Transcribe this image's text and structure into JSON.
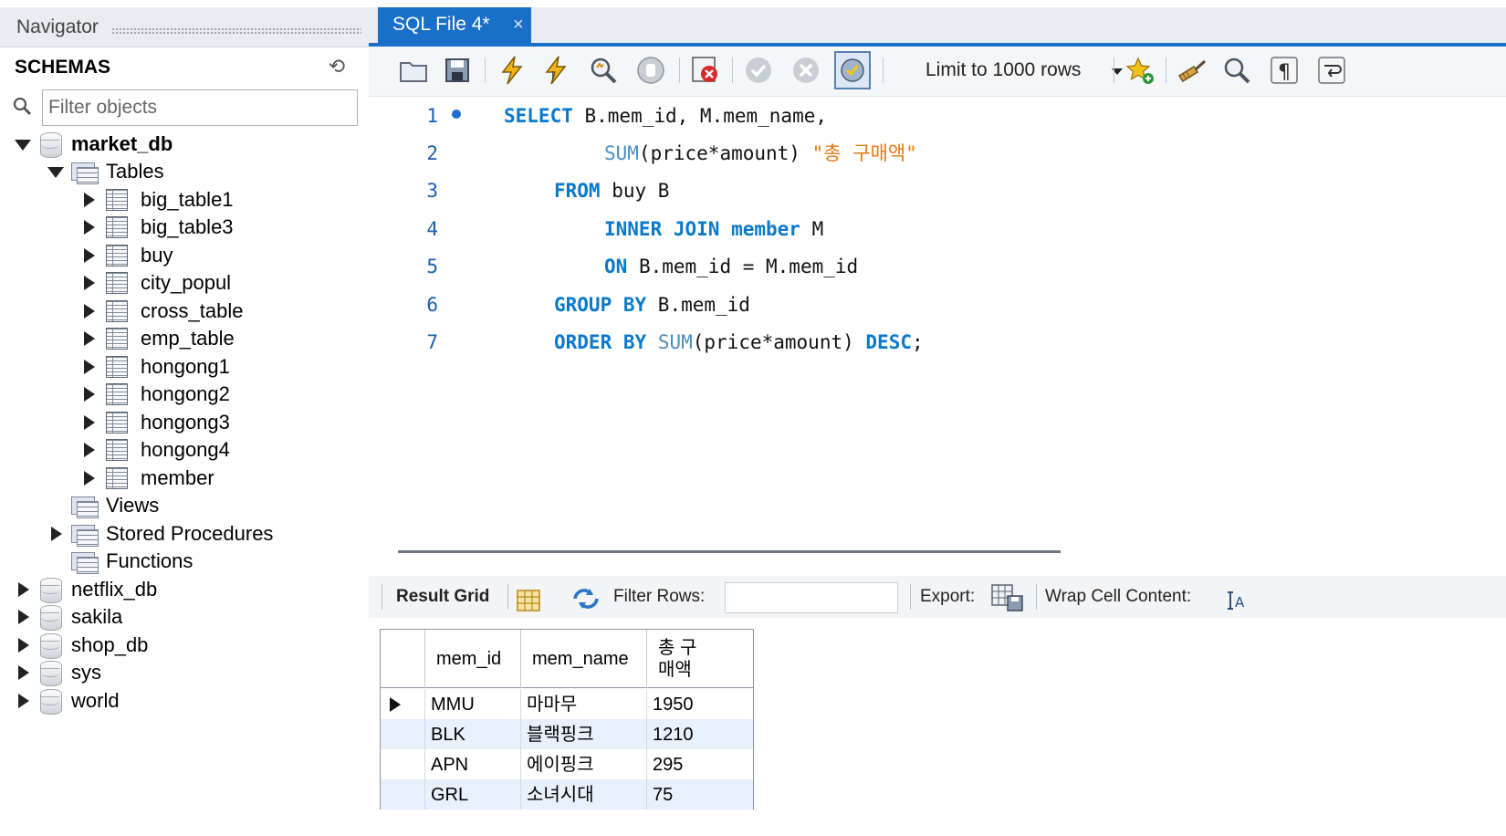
{
  "navigator": {
    "title": "Navigator",
    "schemas_label": "SCHEMAS",
    "filter_placeholder": "Filter objects",
    "tree": {
      "market_db": "market_db",
      "tables_folder": "Tables",
      "tables": [
        "big_table1",
        "big_table3",
        "buy",
        "city_popul",
        "cross_table",
        "emp_table",
        "hongong1",
        "hongong2",
        "hongong3",
        "hongong4",
        "member"
      ],
      "views_folder": "Views",
      "procedures_folder": "Stored Procedures",
      "functions_folder": "Functions",
      "other_dbs": [
        "netflix_db",
        "sakila",
        "shop_db",
        "sys",
        "world"
      ]
    }
  },
  "editor": {
    "tab_title": "SQL File 4*",
    "tab_close": "×",
    "limit_label": "Limit to 1000 rows",
    "line_numbers": [
      "1",
      "2",
      "3",
      "4",
      "5",
      "6",
      "7"
    ],
    "code": {
      "l1_kw": "SELECT",
      "l1_rest": " B.mem_id, M.mem_name,",
      "l2_fn": "SUM",
      "l2_rest": "(price*amount) ",
      "l2_str": "\"총 구매액\"",
      "l3_kw": "FROM",
      "l3_rest": " buy B",
      "l4_kw": "INNER JOIN",
      "l4_kw2": "member",
      "l4_rest": " M",
      "l5_kw": "ON",
      "l5_rest": " B.mem_id = M.mem_id",
      "l6_kw": "GROUP BY",
      "l6_rest": " B.mem_id",
      "l7_kw": "ORDER BY",
      "l7_fn": "SUM",
      "l7_rest": "(price*amount) ",
      "l7_kw2": "DESC",
      "l7_end": ";"
    }
  },
  "results": {
    "result_grid_label": "Result Grid",
    "filter_rows_label": "Filter Rows:",
    "export_label": "Export:",
    "wrap_label": "Wrap Cell Content:",
    "columns": [
      "mem_id",
      "mem_name",
      "총 구\n매액"
    ],
    "column_line1": "총 구",
    "column_line2": "매액",
    "rows": [
      [
        "MMU",
        "마마무",
        "1950"
      ],
      [
        "BLK",
        "블랙핑크",
        "1210"
      ],
      [
        "APN",
        "에이핑크",
        "295"
      ],
      [
        "GRL",
        "소녀시대",
        "75"
      ]
    ]
  },
  "colors": {
    "accent": "#1a6fc9",
    "keyword": "#0b79c9",
    "string": "#e57a15",
    "row_alt": "#e8f0fb"
  }
}
